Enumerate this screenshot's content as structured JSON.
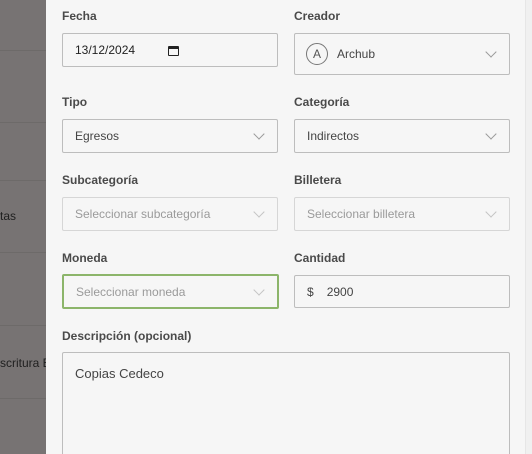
{
  "background": {
    "snippets": [
      "tas",
      "scritura E"
    ]
  },
  "form": {
    "fecha": {
      "label": "Fecha",
      "value": "13/12/2024"
    },
    "creador": {
      "label": "Creador",
      "avatar_initial": "A",
      "value": "Archub"
    },
    "tipo": {
      "label": "Tipo",
      "value": "Egresos"
    },
    "categoria": {
      "label": "Categoría",
      "value": "Indirectos"
    },
    "subcategoria": {
      "label": "Subcategoría",
      "placeholder": "Seleccionar subcategoría"
    },
    "billetera": {
      "label": "Billetera",
      "placeholder": "Seleccionar billetera"
    },
    "moneda": {
      "label": "Moneda",
      "placeholder": "Seleccionar moneda"
    },
    "cantidad": {
      "label": "Cantidad",
      "currency_symbol": "$",
      "value": "2900"
    },
    "descripcion": {
      "label": "Descripción (opcional)",
      "value": "Copias Cedeco"
    }
  },
  "colors": {
    "focus_border": "#8cb56a",
    "panel_bg": "#f6f6f6",
    "overlay": "#7a7675"
  },
  "icons": [
    "calendar-icon",
    "chevron-down-icon"
  ]
}
